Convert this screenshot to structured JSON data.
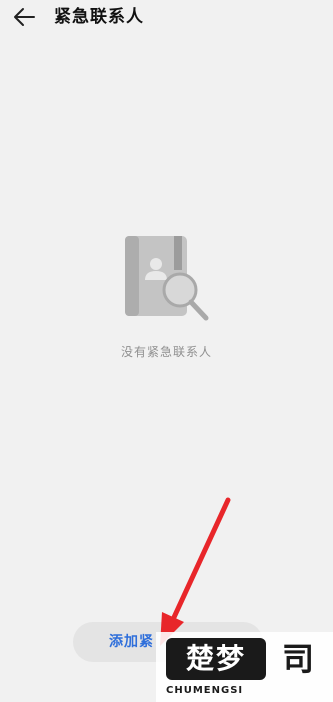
{
  "header": {
    "title": "紧急联系人",
    "back_icon": "arrow-left-icon"
  },
  "empty_state": {
    "icon": "contact-book-search-icon",
    "message": "没有紧急联系人"
  },
  "footer": {
    "add_button_label": "添加紧"
  },
  "annotation": {
    "arrow_color": "#e8262a"
  },
  "watermark": {
    "logo_text": "楚梦",
    "side_text": "司",
    "brand": "CHUMENGSI"
  },
  "colors": {
    "background": "#f1f1f1",
    "accent": "#2f6fdb",
    "button_bg": "#e4e4e4",
    "icon_gray": "#b5b5b5"
  }
}
